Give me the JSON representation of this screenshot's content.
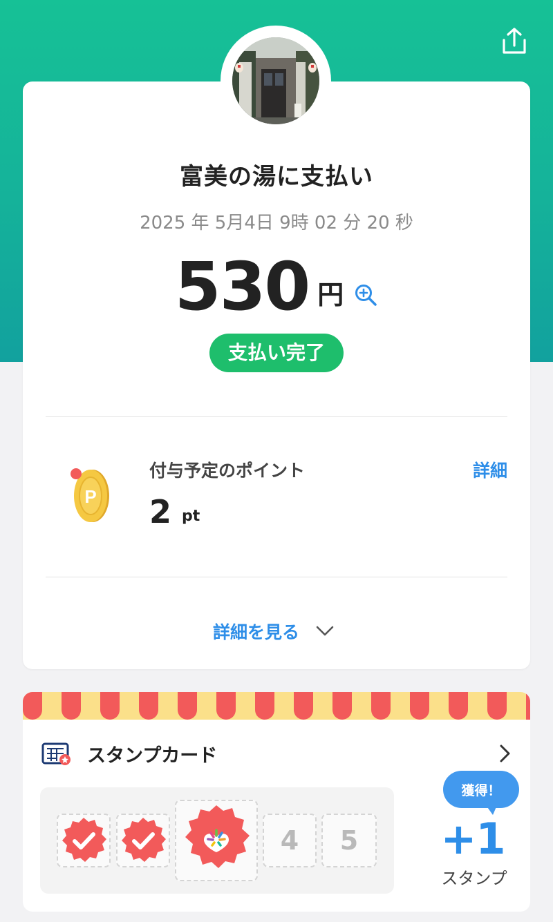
{
  "header": {
    "share_icon": "share-upload-icon"
  },
  "merchant": {
    "photo": "storefront-photo",
    "title": "富美の湯に支払い"
  },
  "transaction": {
    "datetime": "2025 年 5月4日 9時 02 分 20 秒",
    "amount": "530",
    "currency": "円",
    "status": "支払い完了"
  },
  "points": {
    "label": "付与予定のポイント",
    "detail_link": "詳細",
    "value": "2",
    "unit": "pt"
  },
  "details_toggle": {
    "label": "詳細を見る"
  },
  "stamp_card": {
    "title": "スタンプカード",
    "slots": [
      {
        "state": "stamped",
        "label": ""
      },
      {
        "state": "stamped",
        "label": ""
      },
      {
        "state": "new",
        "label": ""
      },
      {
        "state": "empty",
        "label": "4"
      },
      {
        "state": "empty",
        "label": "5"
      }
    ],
    "earned_badge": "獲得！",
    "earned_amount": "+1",
    "earned_caption": "スタンプ"
  },
  "colors": {
    "header_green": "#16c196",
    "status_green": "#1ebe6c",
    "link_blue": "#2e8ee8",
    "stamp_red": "#f25a5a",
    "awning_yellow": "#fbe08a"
  }
}
